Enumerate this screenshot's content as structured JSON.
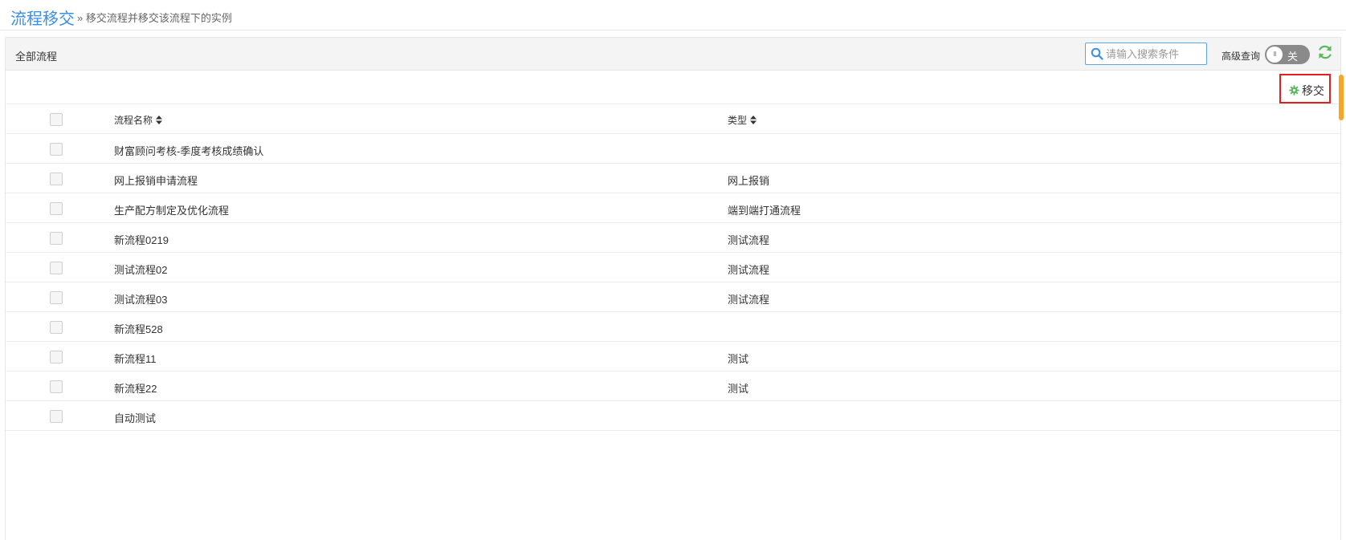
{
  "header": {
    "title": "流程移交",
    "subtitle": "» 移交流程并移交该流程下的实例"
  },
  "panel": {
    "title": "全部流程",
    "search": {
      "placeholder": "请输入搜索条件",
      "value": ""
    },
    "advanced": {
      "label": "高级查询",
      "toggle_text": "关",
      "on": false
    },
    "transfer_label": "移交"
  },
  "table": {
    "columns": [
      "流程名称",
      "类型"
    ],
    "rows": [
      {
        "name": "财富顾问考核-季度考核成绩确认",
        "type": ""
      },
      {
        "name": "网上报销申请流程",
        "type": "网上报销"
      },
      {
        "name": "生产配方制定及优化流程",
        "type": "端到端打通流程"
      },
      {
        "name": "新流程0219",
        "type": "测试流程"
      },
      {
        "name": "测试流程02",
        "type": "测试流程"
      },
      {
        "name": "测试流程03",
        "type": "测试流程"
      },
      {
        "name": "新流程528",
        "type": ""
      },
      {
        "name": "新流程11",
        "type": "测试"
      },
      {
        "name": "新流程22",
        "type": "测试"
      },
      {
        "name": "自动测试",
        "type": ""
      }
    ]
  },
  "colors": {
    "title_blue": "#3a8ee6",
    "highlight_red": "#e02020",
    "gear_green": "#5cb85c",
    "scroll_orange": "#f5a623"
  },
  "icons": [
    "search-icon",
    "refresh-icon",
    "gear-icon",
    "sort-icon"
  ]
}
